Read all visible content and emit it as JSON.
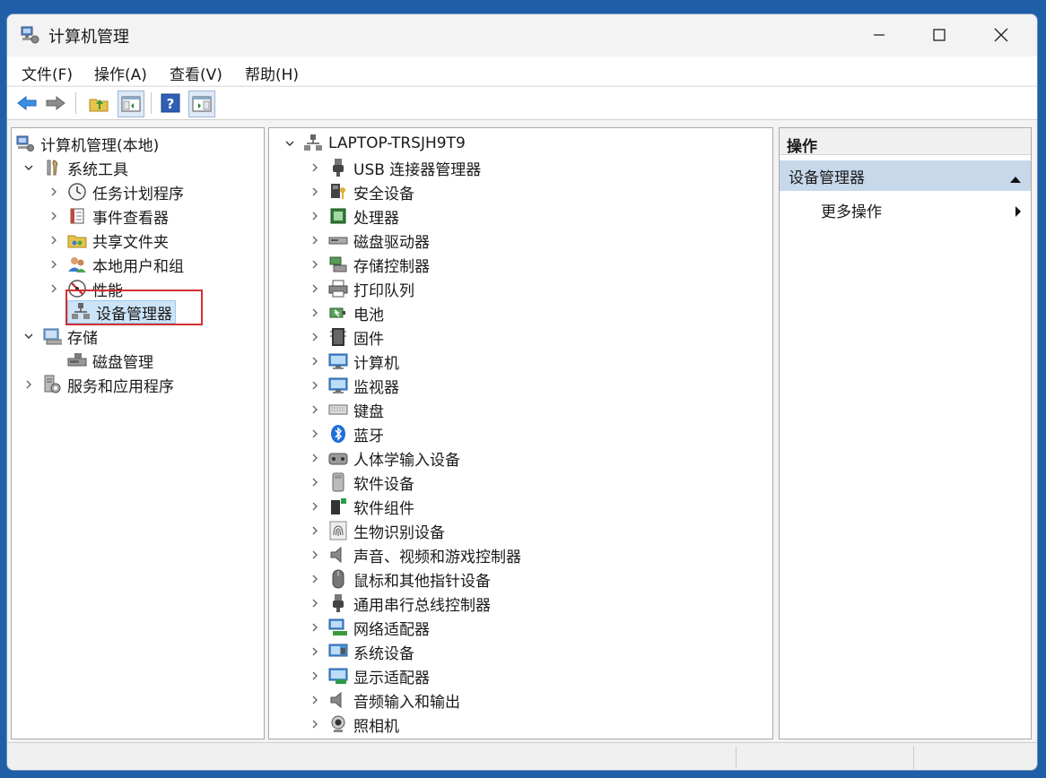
{
  "window": {
    "title": "计算机管理"
  },
  "menu": [
    "文件(F)",
    "操作(A)",
    "查看(V)",
    "帮助(H)"
  ],
  "tree": {
    "root": "计算机管理(本地)",
    "system_tools": "系统工具",
    "task_scheduler": "任务计划程序",
    "event_viewer": "事件查看器",
    "shared_folders": "共享文件夹",
    "local_users": "本地用户和组",
    "performance": "性能",
    "device_manager": "设备管理器",
    "storage": "存储",
    "disk_management": "磁盘管理",
    "services_apps": "服务和应用程序"
  },
  "devices": {
    "computer_name": "LAPTOP-TRSJH9T9",
    "categories": [
      "USB 连接器管理器",
      "安全设备",
      "处理器",
      "磁盘驱动器",
      "存储控制器",
      "打印队列",
      "电池",
      "固件",
      "计算机",
      "监视器",
      "键盘",
      "蓝牙",
      "人体学输入设备",
      "软件设备",
      "软件组件",
      "生物识别设备",
      "声音、视频和游戏控制器",
      "鼠标和其他指针设备",
      "通用串行总线控制器",
      "网络适配器",
      "系统设备",
      "显示适配器",
      "音频输入和输出",
      "照相机"
    ],
    "icons": [
      "usb-plug-icon",
      "security-key-icon",
      "chip-icon",
      "disk-drive-icon",
      "storage-controller-icon",
      "printer-icon",
      "battery-icon",
      "firmware-icon",
      "monitor-icon",
      "monitor-icon",
      "keyboard-icon",
      "bluetooth-icon",
      "hid-icon",
      "software-device-icon",
      "software-component-icon",
      "fingerprint-icon",
      "speaker-icon",
      "mouse-icon",
      "usb-plug-icon",
      "network-adapter-icon",
      "system-device-icon",
      "display-adapter-icon",
      "speaker-icon",
      "webcam-icon"
    ]
  },
  "actions": {
    "header": "操作",
    "section": "设备管理器",
    "more": "更多操作"
  },
  "colors": {
    "accent": "#1f5fa8",
    "selection": "#cce4f7",
    "highlight": "#d32f2f",
    "section": "#c7d8ea"
  }
}
